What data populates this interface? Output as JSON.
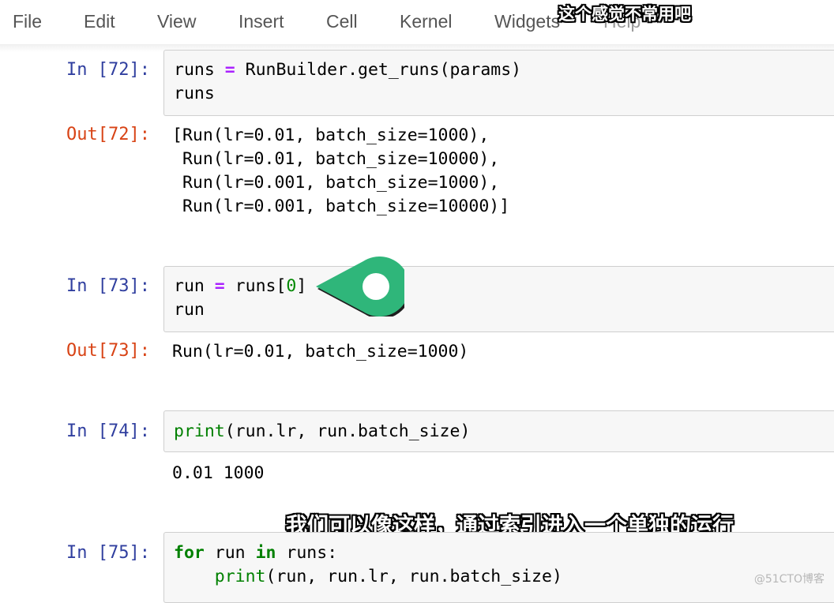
{
  "menu": {
    "items": [
      "File",
      "Edit",
      "View",
      "Insert",
      "Cell",
      "Kernel",
      "Widgets",
      "Help"
    ]
  },
  "subtitles": {
    "top": "这个感觉不常用吧",
    "bottom": "我们可以像这样，通过索引进入一个单独的运行"
  },
  "cells": [
    {
      "in_prompt": "In [72]:",
      "code_lines": [
        "runs = RunBuilder.get_runs(params)",
        "runs"
      ],
      "out_prompt": "Out[72]:",
      "output_lines": [
        "[Run(lr=0.01, batch_size=1000),",
        " Run(lr=0.01, batch_size=10000),",
        " Run(lr=0.001, batch_size=1000),",
        " Run(lr=0.001, batch_size=10000)]"
      ]
    },
    {
      "in_prompt": "In [73]:",
      "code_lines": [
        "run = runs[0]",
        "run"
      ],
      "out_prompt": "Out[73]:",
      "output_lines": [
        "Run(lr=0.01, batch_size=1000)"
      ]
    },
    {
      "in_prompt": "In [74]:",
      "code_lines": [
        "print(run.lr, run.batch_size)"
      ],
      "output_lines": [
        "0.01 1000"
      ]
    },
    {
      "in_prompt": "In [75]:",
      "code_lines": [
        "for run in runs:",
        "    print(run, run.lr, run.batch_size)"
      ]
    }
  ],
  "watermark": "@51CTO博客",
  "colors": {
    "in_prompt": "#303f9f",
    "out_prompt": "#d84315",
    "pointer": "#2fb67a"
  }
}
